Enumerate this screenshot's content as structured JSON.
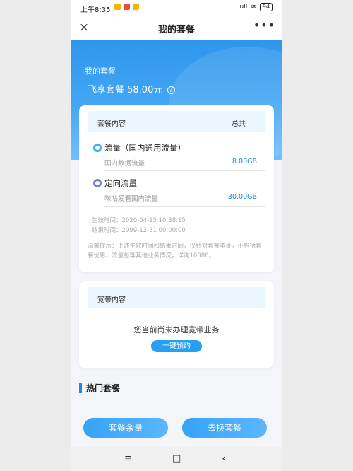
{
  "status_bar": {
    "time": "上午8:35",
    "signal": "ull",
    "battery": "94"
  },
  "nav": {
    "close_icon": "×",
    "title": "我的套餐",
    "more_icon": "•••"
  },
  "hero": {
    "label": "我的套餐",
    "plan": "飞享套餐 58.00元",
    "help_icon": "?"
  },
  "package": {
    "header_left": "套餐内容",
    "header_right": "总共",
    "items": [
      {
        "name": "流量（国内通用流量）",
        "sub": "国内数据流量",
        "value": "8.00GB",
        "dot_color": "#35b4f0"
      },
      {
        "name": "定向流量",
        "sub": "咪咕爱看国内流量",
        "value": "30.00GB",
        "dot_color": "#7a7fd6"
      }
    ],
    "start": "生效时间：2020-04-25 10:38:15",
    "end": "结束时间：2099-12-31 00:00:00",
    "tip": "温馨提示：上述生效时间和结束时间，仅针对套餐本身，不包括套餐优惠、流量包等其他业务情况，详询10086。"
  },
  "broadband": {
    "header": "宽带内容",
    "empty_text": "您当前尚未办理宽带业务",
    "book_label": "一键预约"
  },
  "hot": {
    "title": "热门套餐"
  },
  "buttons": {
    "balance_label": "套餐余量",
    "change_label": "去换套餐"
  },
  "system_nav": {
    "menu": "≡",
    "home": "□",
    "back": "‹"
  },
  "colors": {
    "accent": "#1e88e5",
    "hero_top": "#2f95ec",
    "hero_bottom": "#6fc0ff"
  }
}
